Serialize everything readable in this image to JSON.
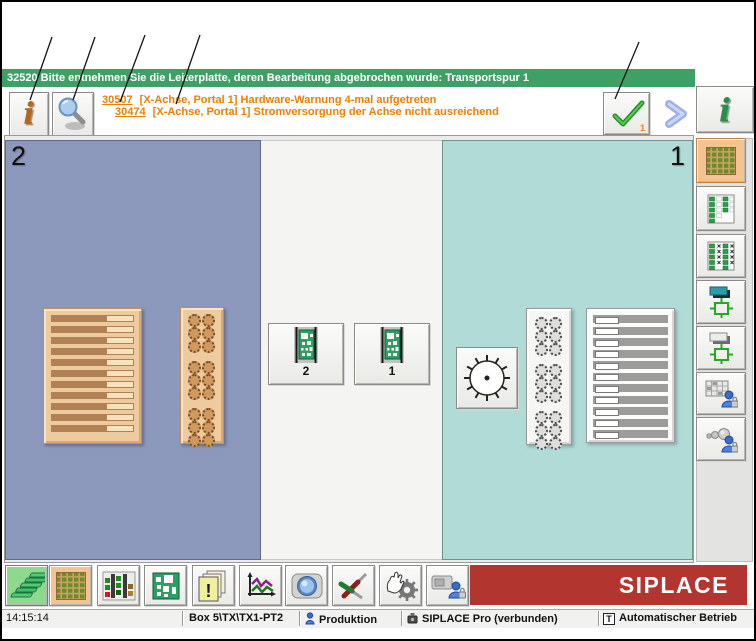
{
  "message_bar": {
    "text": "32520 Bitte entnehmen Sie die Leiterplatte, deren Bearbeitung abgebrochen wurde: Transportspur 1",
    "bg_color": "#3fa065"
  },
  "warnings": [
    {
      "code": "30507",
      "text": "[X-Achse, Portal 1] Hardware-Warnung 4-mal aufgetreten"
    },
    {
      "code": "30474",
      "text": "[X-Achse, Portal 1] Stromversorgung der Achse nicht ausreichend"
    }
  ],
  "warning_color": "#ee7f00",
  "toolbar_top": {
    "info_glyph": "i",
    "ack_badge": "1"
  },
  "sidebar": {
    "info_glyph": "i",
    "icons": [
      "info-icon",
      "station-grid-icon",
      "table-columns-icon",
      "table-x-icon",
      "component-crosshair-icon",
      "block-crosshair-icon",
      "table-user-lock-icon",
      "feeder-user-lock-icon"
    ]
  },
  "panels": {
    "left": {
      "label": "2",
      "color": "#8d98bd"
    },
    "right": {
      "label": "1",
      "color": "#b1dbd7"
    }
  },
  "lanes": [
    {
      "label": "2"
    },
    {
      "label": "1"
    }
  ],
  "toolbar_bottom": {
    "warning_glyph": "!",
    "icons": [
      "layer-stack-icon",
      "station-grid-icon",
      "levels-icon",
      "pcb-icon",
      "warning-pages-icon",
      "trend-chart-icon",
      "camera-icon",
      "tools-icon",
      "hand-gear-icon",
      "machine-user-lock-icon"
    ]
  },
  "brand": {
    "logo": "SIPLACE",
    "bg_color": "#b23530"
  },
  "statusbar": {
    "time": "14:15:14",
    "machine": "Box 5\\TX\\TX1-PT2",
    "mode": "Produktion",
    "connection": "SIPLACE Pro (verbunden)",
    "operation_icon_glyph": "T",
    "operation": "Automatischer Betrieb"
  }
}
